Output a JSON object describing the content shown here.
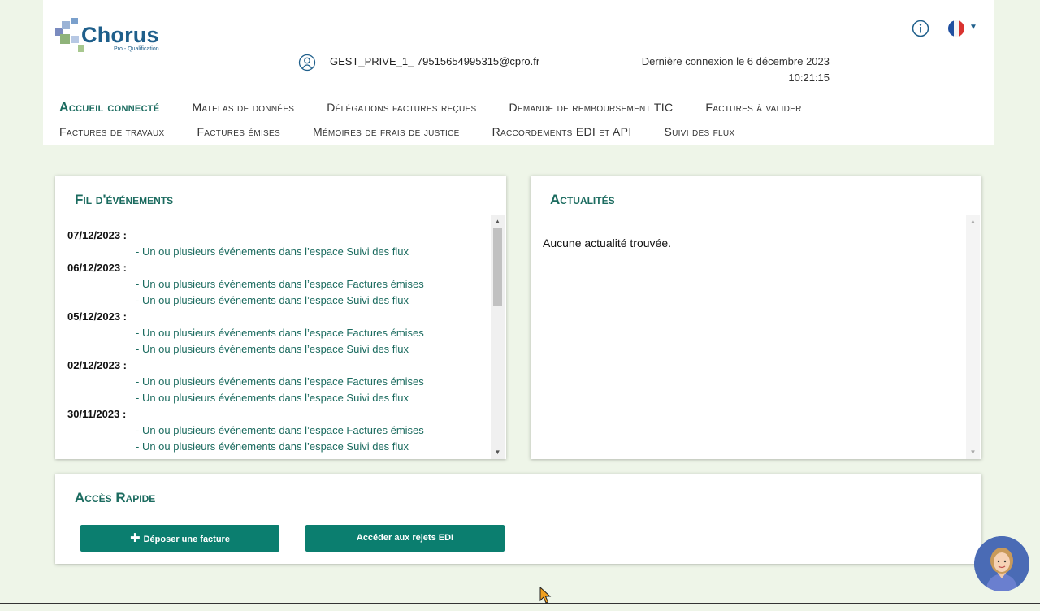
{
  "brand": {
    "name": "Chorus",
    "sub": "Pro - Qualification"
  },
  "header": {
    "user_email": "GEST_PRIVE_1_ 79515654995315@cpro.fr",
    "last_login_line1": "Dernière connexion le 6 décembre 2023",
    "last_login_line2": "10:21:15"
  },
  "nav": {
    "row1": [
      "Accueil connecté",
      "Matelas de données",
      "Délégations factures reçues",
      "Demande de remboursement TIC",
      "Factures à valider"
    ],
    "row2": [
      "Factures de travaux",
      "Factures émises",
      "Mémoires de frais de justice",
      "Raccordements EDI et API",
      "Suivi des flux"
    ]
  },
  "events": {
    "title": "Fil d'événements",
    "groups": [
      {
        "date": "07/12/2023 :",
        "lines": [
          "- Un ou plusieurs événements dans l’espace Suivi des flux"
        ]
      },
      {
        "date": "06/12/2023 :",
        "lines": [
          "- Un ou plusieurs événements dans l’espace Factures émises",
          "- Un ou plusieurs événements dans l’espace Suivi des flux"
        ]
      },
      {
        "date": "05/12/2023 :",
        "lines": [
          "- Un ou plusieurs événements dans l’espace Factures émises",
          "- Un ou plusieurs événements dans l’espace Suivi des flux"
        ]
      },
      {
        "date": "02/12/2023 :",
        "lines": [
          "- Un ou plusieurs événements dans l’espace Factures émises",
          "- Un ou plusieurs événements dans l’espace Suivi des flux"
        ]
      },
      {
        "date": "30/11/2023 :",
        "lines": [
          "- Un ou plusieurs événements dans l’espace Factures émises",
          "- Un ou plusieurs événements dans l’espace Suivi des flux"
        ]
      }
    ]
  },
  "news": {
    "title": "Actualités",
    "empty": "Aucune actualité trouvée."
  },
  "quick_access": {
    "title": "Accès Rapide",
    "deposit_button": "Déposer une facture",
    "edi_button": "Accéder aux rejets EDI"
  },
  "colors": {
    "accent": "#1b6b5f",
    "button": "#0b7e6f",
    "background": "#eef5e8",
    "brand": "#1f5f8b"
  },
  "icons": [
    "info-icon",
    "french-flag-icon",
    "user-icon",
    "plus-icon",
    "assistant-avatar-icon"
  ]
}
